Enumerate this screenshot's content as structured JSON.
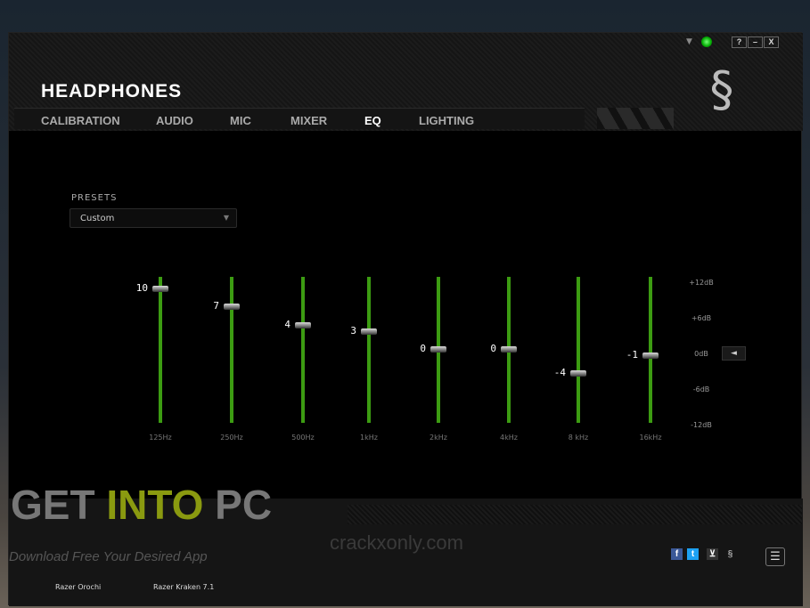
{
  "window": {
    "title": "HEADPHONES",
    "controls": [
      "?",
      "–",
      "X"
    ]
  },
  "tabs": [
    {
      "label": "CALIBRATION"
    },
    {
      "label": "AUDIO"
    },
    {
      "label": "MIC"
    },
    {
      "label": "MIXER"
    },
    {
      "label": "EQ",
      "active": true
    },
    {
      "label": "LIGHTING"
    }
  ],
  "presets": {
    "label": "PRESETS",
    "value": "Custom"
  },
  "eq": {
    "range_db": [
      -12,
      12
    ],
    "accent": "#3c9c12",
    "bands": [
      {
        "freq": "125Hz",
        "value": 10,
        "label": "10"
      },
      {
        "freq": "250Hz",
        "value": 7,
        "label": "7"
      },
      {
        "freq": "500Hz",
        "value": 4,
        "label": "4"
      },
      {
        "freq": "1kHz",
        "value": 3,
        "label": "3"
      },
      {
        "freq": "2kHz",
        "value": 0,
        "label": "0"
      },
      {
        "freq": "4kHz",
        "value": 0,
        "label": "0"
      },
      {
        "freq": "8 kHz",
        "value": -4,
        "label": "-4"
      },
      {
        "freq": "16kHz",
        "value": -1,
        "label": "-1"
      }
    ],
    "scale": [
      "+12dB",
      "+6dB",
      "0dB",
      "-6dB",
      "-12dB"
    ],
    "reset_icon": "◄"
  },
  "footer": {
    "devices": [
      "Razer Orochi",
      "Razer Kraken 7.1"
    ],
    "social": [
      "facebook-icon",
      "twitter-icon",
      "cart-icon",
      "razer-icon"
    ],
    "menu_icon": "☰"
  },
  "watermarks": {
    "brand_a": "GET ",
    "brand_b": "INTO",
    "brand_c": " PC",
    "tagline": "Download Free Your Desired App",
    "site": "crackxonly.com"
  }
}
